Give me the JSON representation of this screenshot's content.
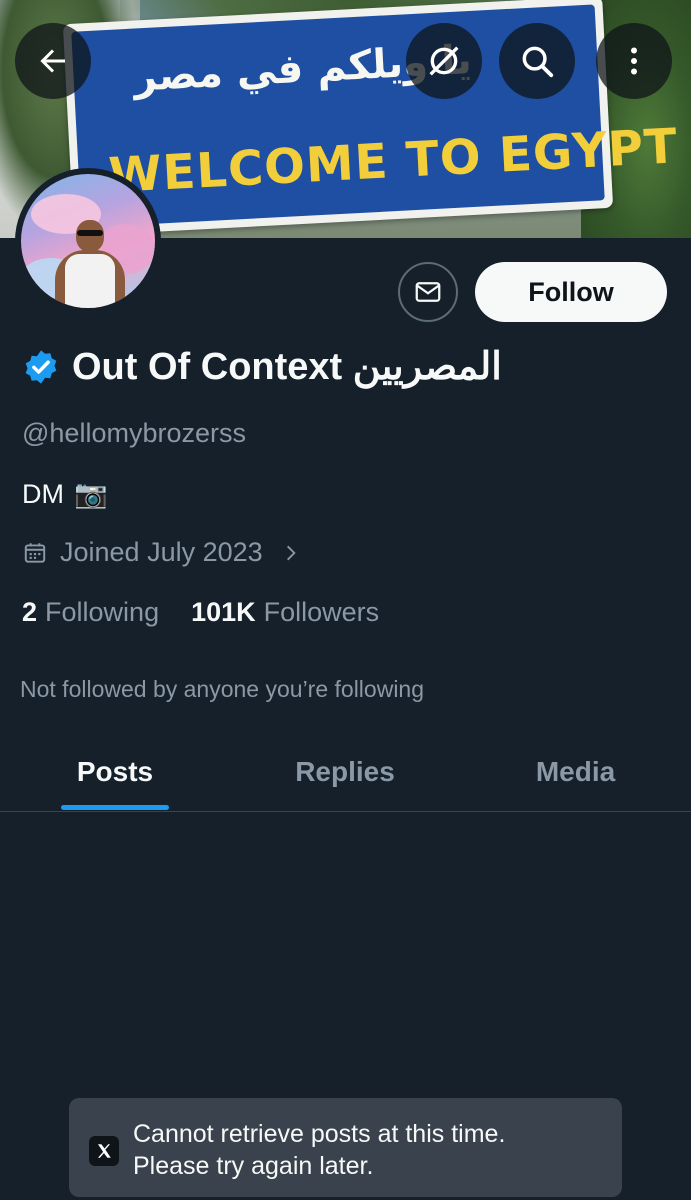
{
  "banner": {
    "sign_arabic": "يا ويلكم في مصر",
    "sign_english": "WELCOME TO EGYPT"
  },
  "header_buttons": {
    "back_icon": "arrow-left-icon",
    "grok_icon": "grok-icon",
    "search_icon": "search-icon",
    "more_icon": "more-vertical-icon"
  },
  "profile": {
    "display_name": "Out Of Context المصريين",
    "verified": true,
    "handle": "@hellomybrozerss",
    "bio": "DM",
    "bio_emoji": "📷",
    "joined": "Joined July 2023",
    "following_count": "2",
    "following_label": "Following",
    "followers_count": "101K",
    "followers_label": "Followers",
    "not_followed_text": "Not followed by anyone you’re following"
  },
  "actions": {
    "message_icon": "mail-icon",
    "follow_label": "Follow"
  },
  "tabs": [
    {
      "label": "Posts",
      "active": true
    },
    {
      "label": "Replies",
      "active": false
    },
    {
      "label": "Media",
      "active": false
    }
  ],
  "toast": {
    "line1": "Cannot retrieve posts at this time.",
    "line2": "Please try again later."
  },
  "colors": {
    "background": "#15202b",
    "accent": "#1d9bf0",
    "secondary_text": "#8b98a5",
    "primary_text": "#f7f9f9"
  }
}
